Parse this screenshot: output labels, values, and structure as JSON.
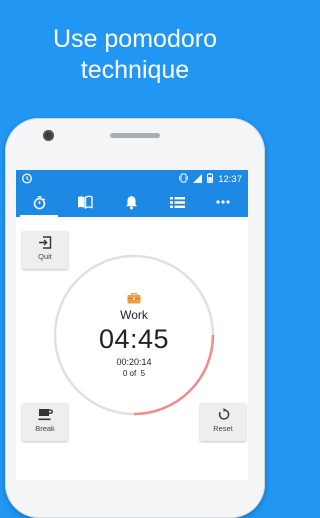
{
  "headline": {
    "line1": "Use pomodoro",
    "line2": "technique"
  },
  "status_bar": {
    "time": "12:37"
  },
  "tabs": [
    {
      "icon": "stopwatch-icon",
      "active": true
    },
    {
      "icon": "book-icon",
      "active": false
    },
    {
      "icon": "bell-icon",
      "active": false
    },
    {
      "icon": "list-icon",
      "active": false
    },
    {
      "icon": "more-icon",
      "active": false
    }
  ],
  "actions": {
    "quit": "Quit",
    "break": "Break",
    "reset": "Reset"
  },
  "timer": {
    "label": "Work",
    "remaining": "04:45",
    "elapsed": "00:20:14",
    "progress_text": "0 of  5",
    "progress_fraction": 0.25
  },
  "colors": {
    "header_bg": "#2196f3",
    "app_bar": "#1e88e5",
    "ring_track": "#e0e0e0",
    "ring_progress": "#f28b8b",
    "briefcase": "#f39c3d"
  }
}
